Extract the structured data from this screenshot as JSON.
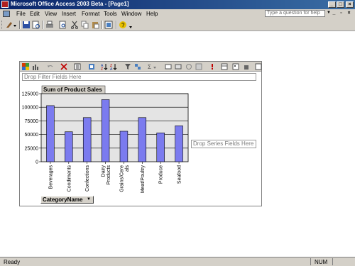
{
  "window": {
    "title": "Microsoft Office Access 2003 Beta - [Page1]"
  },
  "menu": [
    "File",
    "Edit",
    "View",
    "Insert",
    "Format",
    "Tools",
    "Window",
    "Help"
  ],
  "help_box": {
    "placeholder": "Type a question for help"
  },
  "pivot": {
    "drop_filter": "Drop Filter Fields Here",
    "drop_series": "Drop Series Fields Here",
    "data_field": "Sum of Product Sales",
    "category_field": "CategoryName"
  },
  "chart_data": {
    "type": "bar",
    "title": "",
    "categories": [
      "Beverages",
      "Condiments",
      "Confections",
      "Dairy Products",
      "Grains/Cereals",
      "Meat/Poultry",
      "Produce",
      "Seafood"
    ],
    "category_lines": [
      [
        "Beverages"
      ],
      [
        "Condiments"
      ],
      [
        "Confections"
      ],
      [
        "Dairy",
        "Products"
      ],
      [
        "Grains/Cere",
        "als"
      ],
      [
        "Meat/Poultry"
      ],
      [
        "Produce"
      ],
      [
        "Seafood"
      ]
    ],
    "series": [
      {
        "values": [
          103000,
          55000,
          81000,
          114000,
          56000,
          81000,
          53000,
          66000
        ]
      }
    ],
    "yticks": [
      "0",
      "25000",
      "50000",
      "75000",
      "100000",
      "125000"
    ],
    "ylim": [
      0,
      125000
    ],
    "grid": true,
    "bar_color": "#7b7bef"
  },
  "status": {
    "left": "Ready",
    "right": "NUM"
  }
}
